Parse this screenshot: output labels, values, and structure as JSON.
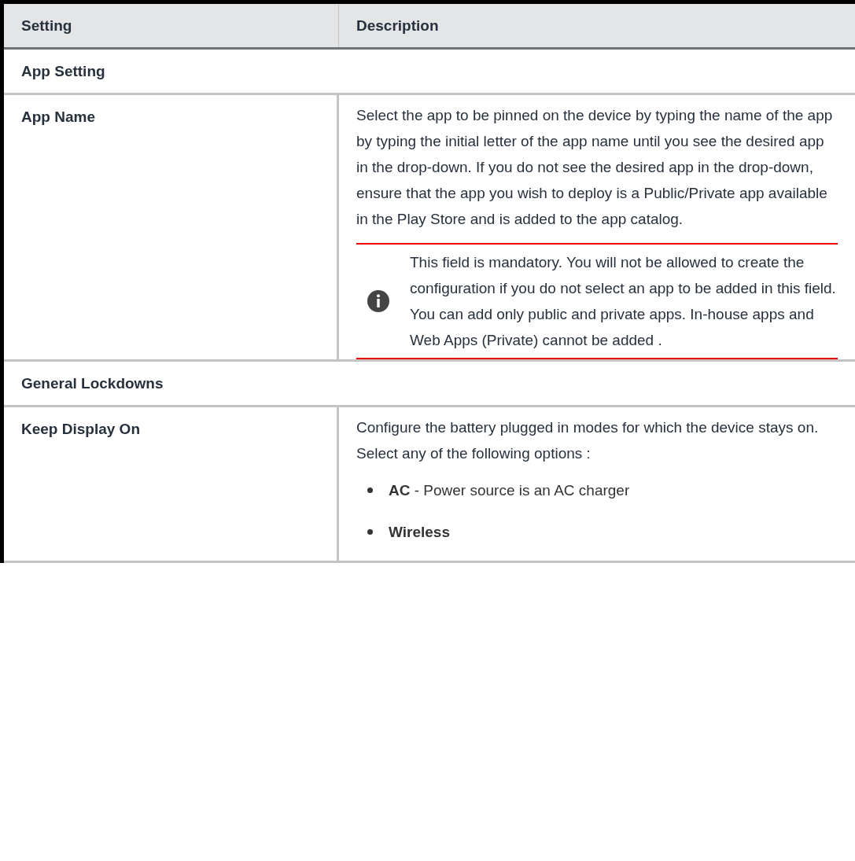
{
  "table": {
    "columns": [
      "Setting",
      "Description"
    ],
    "rows": [
      {
        "kind": "section",
        "label": "App Setting"
      },
      {
        "kind": "setting",
        "label": "App Name",
        "description": [
          {
            "kind": "paragraph",
            "text": "Select the app to be pinned on the device by typing the name of the app by typing the initial letter of the app name until you see the desired app in the drop-down. If you do not see the desired app in the drop-down, ensure that the app you wish to deploy is a Public/Private app available in the Play Store and is added to the app catalog."
          },
          {
            "kind": "note",
            "text": "This field is mandatory. You will not be allowed to create the configuration if you do not select an app to be added in this field. You can add only public and private apps. In-house apps and Web Apps (Private) cannot be added ."
          }
        ]
      },
      {
        "kind": "section",
        "label": "General Lockdowns"
      },
      {
        "kind": "setting",
        "label": "Keep Display On",
        "description": [
          {
            "kind": "paragraph",
            "text": "Configure the battery plugged in modes for which the device stays on. Select any of the following options :"
          },
          {
            "kind": "bullet",
            "text": "**AC** - Power source is an AC charger"
          },
          {
            "kind": "bullet",
            "text": "**Wireless**"
          }
        ]
      }
    ]
  }
}
